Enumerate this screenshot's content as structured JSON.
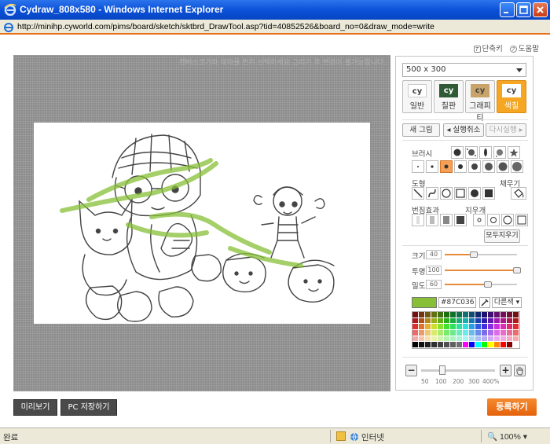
{
  "window": {
    "title": "Cydraw_808x580 - Windows Internet Explorer",
    "url": "http://minihp.cyworld.com/pims/board/sketch/sktbrd_DrawTool.asp?tid=40852526&board_no=0&draw_mode=write"
  },
  "top_links": {
    "shortcut": "단축키",
    "help": "도움말"
  },
  "canvas": {
    "hint": "캔버스크기와 테마를 먼저 선택하세요 그리기 후 변경이 불가능합니다."
  },
  "panel": {
    "canvas_size": "500 x 300",
    "bg_tabs": [
      {
        "label": "일반",
        "thumb": "cy"
      },
      {
        "label": "칠판",
        "thumb": "cy"
      },
      {
        "label": "그래피티",
        "thumb": "cy"
      },
      {
        "label": "색칠",
        "thumb": "cy"
      }
    ],
    "actions": {
      "new": "새 그림",
      "undo": "실행취소",
      "redo": "다시실행"
    },
    "brush_label": "브러시",
    "shape_label": "도형",
    "fill_label": "채우기",
    "blur_label": "번짐효과",
    "eraser_label": "지우개",
    "erase_all": "모두지우기",
    "sliders": [
      {
        "label": "크기",
        "value": "40",
        "level": 0.4
      },
      {
        "label": "투명",
        "value": "100",
        "level": 1.0
      },
      {
        "label": "밀도",
        "value": "60",
        "level": 0.6
      }
    ],
    "color_hex": "#87C036",
    "more_colors": "다른색",
    "zoom_ticks": [
      "50",
      "100",
      "200",
      "300",
      "400%"
    ]
  },
  "buttons": {
    "preview": "미리보기",
    "save_pc": "PC 저장하기",
    "register": "등록하기"
  },
  "status": {
    "done": "완료",
    "zone": "인터넷",
    "zoom": "100%"
  },
  "colors": {
    "accent": "#e8701b",
    "selected_color": "#87C036"
  }
}
